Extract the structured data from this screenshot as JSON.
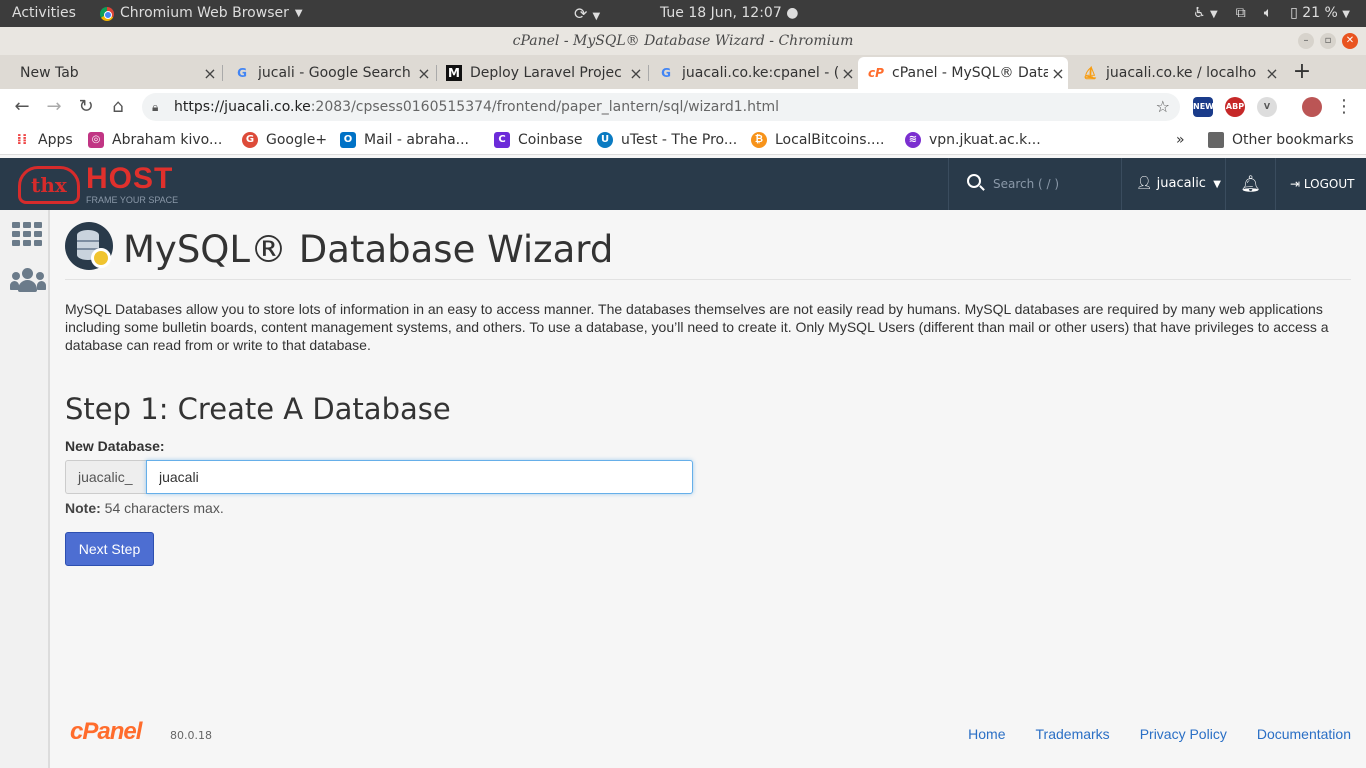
{
  "system_bar": {
    "activities": "Activities",
    "app_name": "Chromium Web Browser",
    "clock": "Tue 18 Jun, 12:07",
    "battery": "21 %"
  },
  "window": {
    "title": "cPanel - MySQL® Database Wizard - Chromium"
  },
  "tabs": [
    {
      "label": "New Tab",
      "icon": "none"
    },
    {
      "label": "jucali - Google Search",
      "icon": "google-icon"
    },
    {
      "label": "Deploy Laravel Projec",
      "icon": "medium-icon"
    },
    {
      "label": "juacali.co.ke:cpanel - (",
      "icon": "google-icon"
    },
    {
      "label": "cPanel - MySQL® Data",
      "icon": "cpanel-icon",
      "active": true
    },
    {
      "label": "juacali.co.ke / localho",
      "icon": "phpmyadmin-icon"
    }
  ],
  "address_bar": {
    "url_host": "https://juacali.co.ke",
    "url_rest": ":2083/cpsess0160515374/frontend/paper_lantern/sql/wizard1.html"
  },
  "extensions": [
    "NEW",
    "ABP",
    "V"
  ],
  "bookmarks": {
    "items": [
      {
        "label": "Apps",
        "icon": "apps-grid-icon",
        "color": "#e44"
      },
      {
        "label": "Abraham kivo...",
        "icon": "instagram-icon",
        "color": "#c13584"
      },
      {
        "label": "Google+",
        "icon": "google-plus-icon",
        "color": "#dd4b39"
      },
      {
        "label": "Mail - abraha...",
        "icon": "outlook-icon",
        "color": "#0072c6"
      },
      {
        "label": "Coinbase",
        "icon": "coinbase-icon",
        "color": "#6c2bd9"
      },
      {
        "label": "uTest - The Pro...",
        "icon": "utest-icon",
        "color": "#0a7bc2"
      },
      {
        "label": "LocalBitcoins....",
        "icon": "localbitcoins-icon",
        "color": "#f7931a"
      },
      {
        "label": "vpn.jkuat.ac.k...",
        "icon": "vpn-icon",
        "color": "#7b2fd0"
      }
    ],
    "overflow": "»",
    "other": "Other bookmarks"
  },
  "cpanel_header": {
    "logo_text": "HOST",
    "logo_mark": "thx",
    "logo_tagline": "FRAME YOUR SPACE",
    "search_placeholder": "Search ( / )",
    "username": "juacalic",
    "logout": "LOGOUT"
  },
  "page": {
    "title": "MySQL® Database Wizard",
    "intro": "MySQL Databases allow you to store lots of information in an easy to access manner. The databases themselves are not easily read by humans. MySQL databases are required by many web applications including some bulletin boards, content management systems, and others. To use a database, you’ll need to create it. Only MySQL Users (different than mail or other users) that have privileges to access a database can read from or write to that database.",
    "step_title": "Step 1: Create A Database",
    "field_label": "New Database:",
    "db_prefix": "juacalic_",
    "db_value": "juacali",
    "note_label": "Note:",
    "note_text": "54 characters max.",
    "next_button": "Next Step"
  },
  "footer": {
    "logo": "cPanel",
    "version": "80.0.18",
    "links": [
      "Home",
      "Trademarks",
      "Privacy Policy",
      "Documentation"
    ]
  }
}
